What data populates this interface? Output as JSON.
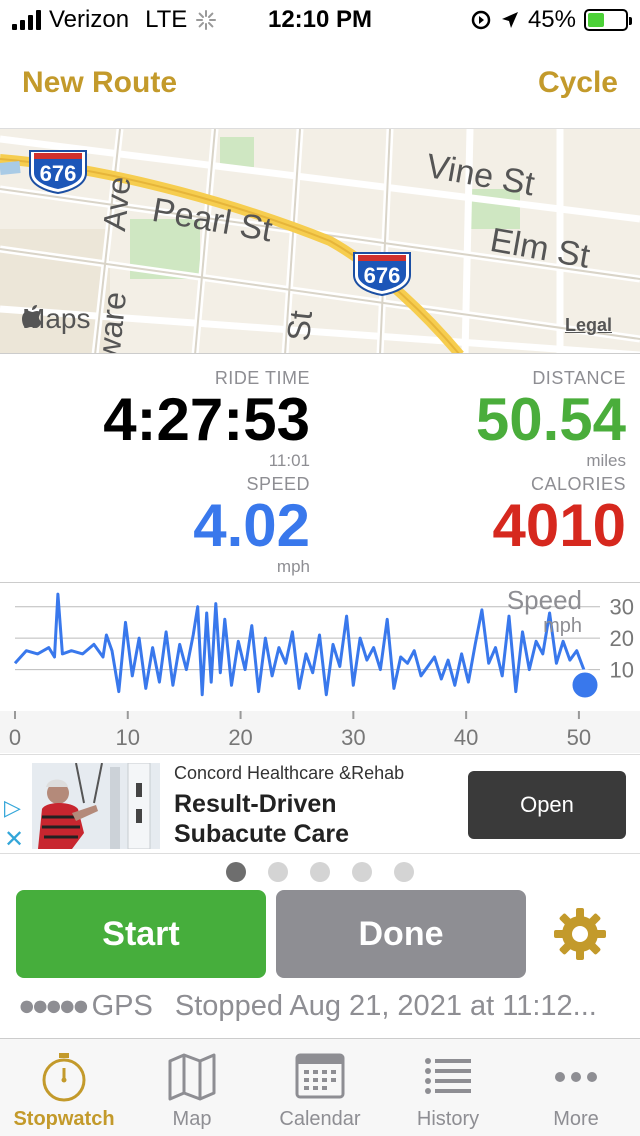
{
  "status_bar": {
    "carrier": "Verizon",
    "network": "LTE",
    "time": "12:10 PM",
    "battery_text": "45%",
    "battery_level": 0.45
  },
  "header": {
    "left_label": "New Route",
    "right_label": "Cycle"
  },
  "map": {
    "streets": [
      "Vine St",
      "Pearl St",
      "Elm St",
      "Ave",
      "ware",
      "St"
    ],
    "highway_shields": [
      "676",
      "676"
    ],
    "brand": "Maps",
    "legal_label": "Legal"
  },
  "stats": {
    "ride_time": {
      "label": "RIDE TIME",
      "value": "4:27:53",
      "sub": "11:01",
      "color": "#000000"
    },
    "distance": {
      "label": "DISTANCE",
      "value": "50.54",
      "unit": "miles",
      "color": "#4aad3b"
    },
    "speed": {
      "label": "SPEED",
      "value": "4.02",
      "unit": "mph",
      "color": "#3978ec"
    },
    "calories": {
      "label": "CALORIES",
      "value": "4010",
      "color": "#d6281e"
    }
  },
  "chart_data": {
    "type": "line",
    "title": "Speed",
    "unit": "mph",
    "x_ticks": [
      "0",
      "10",
      "20",
      "30",
      "40",
      "50"
    ],
    "y_ticks": [
      "30",
      "20",
      "10"
    ],
    "xlim": [
      0,
      50.54
    ],
    "ylim": [
      0,
      35
    ],
    "grid": true,
    "series": [
      {
        "color": "#3978ec",
        "x": [
          0,
          1,
          2,
          3,
          3.5,
          3.8,
          4.2,
          5,
          6,
          7,
          7.8,
          8.1,
          8.6,
          9.2,
          9.8,
          10.4,
          11,
          11.6,
          12.2,
          12.8,
          13.4,
          14,
          14.6,
          15.2,
          15.8,
          16.2,
          16.6,
          17,
          17.4,
          17.8,
          18.2,
          18.6,
          19.2,
          19.8,
          20.4,
          21,
          21.6,
          22.2,
          22.8,
          23.4,
          24,
          24.6,
          25.2,
          25.8,
          26.4,
          27,
          27.6,
          28.2,
          28.8,
          29.4,
          30,
          30.6,
          31.2,
          31.8,
          32.4,
          33,
          33.6,
          34.2,
          34.8,
          35.4,
          36,
          36.6,
          37.2,
          37.8,
          38.4,
          39,
          39.6,
          40.2,
          40.8,
          41.4,
          42,
          42.6,
          43.2,
          43.8,
          44.4,
          45,
          45.6,
          46.2,
          46.8,
          47.4,
          48,
          48.6,
          49.2,
          49.8,
          50.54
        ],
        "y": [
          12,
          16,
          15,
          17,
          14,
          34,
          15,
          16,
          15,
          18,
          14,
          21,
          16,
          3,
          25,
          8,
          20,
          4,
          17,
          6,
          22,
          5,
          18,
          10,
          21,
          30,
          2,
          28,
          6,
          31,
          9,
          26,
          5,
          19,
          10,
          24,
          3,
          20,
          8,
          17,
          12,
          22,
          4,
          15,
          9,
          21,
          2,
          18,
          11,
          27,
          5,
          20,
          13,
          17,
          10,
          26,
          4,
          14,
          12,
          16,
          8,
          11,
          14,
          7,
          13,
          5,
          15,
          6,
          18,
          29,
          12,
          17,
          8,
          27,
          3,
          22,
          10,
          19,
          15,
          28,
          12,
          19,
          13,
          16,
          9
        ]
      }
    ]
  },
  "ad": {
    "sponsor": "Concord Healthcare &Rehab",
    "headline_line1": "Result-Driven",
    "headline_line2": "Subacute Care",
    "cta": "Open"
  },
  "pager": {
    "count": 5,
    "active": 0
  },
  "actions": {
    "start": "Start",
    "done": "Done"
  },
  "gps": {
    "label": "GPS",
    "status": "Stopped Aug 21, 2021 at 11:12..."
  },
  "tabs": [
    {
      "label": "Stopwatch",
      "icon": "stopwatch-icon",
      "active": true
    },
    {
      "label": "Map",
      "icon": "map-icon",
      "active": false
    },
    {
      "label": "Calendar",
      "icon": "calendar-icon",
      "active": false
    },
    {
      "label": "History",
      "icon": "history-list-icon",
      "active": false
    },
    {
      "label": "More",
      "icon": "more-icon",
      "active": false
    }
  ],
  "colors": {
    "accent": "#c39a2b",
    "start": "#46ae3c",
    "done": "#8e8e93"
  }
}
